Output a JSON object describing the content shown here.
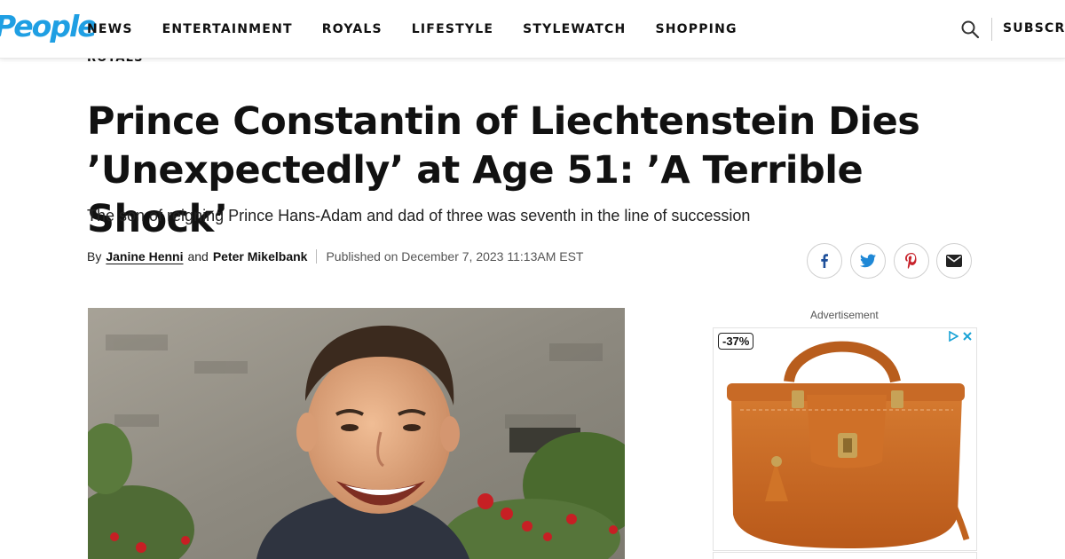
{
  "header": {
    "logo_text": "People",
    "nav_items": [
      "NEWS",
      "ENTERTAINMENT",
      "ROYALS",
      "LIFESTYLE",
      "STYLEWATCH",
      "SHOPPING"
    ],
    "subscribe_label": "SUBSCRIBE",
    "search_icon": "search-icon",
    "brand_color": "#1f9fe3"
  },
  "article": {
    "kicker": "ROYALS",
    "headline_line1": "Prince Constantin of Liechtenstein Dies",
    "headline_line2": "’Unexpectedly’ at Age 51: ’A Terrible Shock’",
    "dek": "The son of reigning Prince Hans-Adam and dad of three was seventh in the line of succession",
    "byline": {
      "prefix": "By",
      "author1": "Janine Henni",
      "conjunction": "and",
      "author2": "Peter Mikelbank",
      "published": "Published on December 7, 2023 11:13AM EST"
    },
    "share_icons": [
      "facebook-icon",
      "twitter-icon",
      "pinterest-icon",
      "email-icon"
    ]
  },
  "ad": {
    "label": "Advertisement",
    "discount": "-37%",
    "colors": {
      "bag": "#c8681f",
      "adchoices": "#19a3d6"
    }
  }
}
